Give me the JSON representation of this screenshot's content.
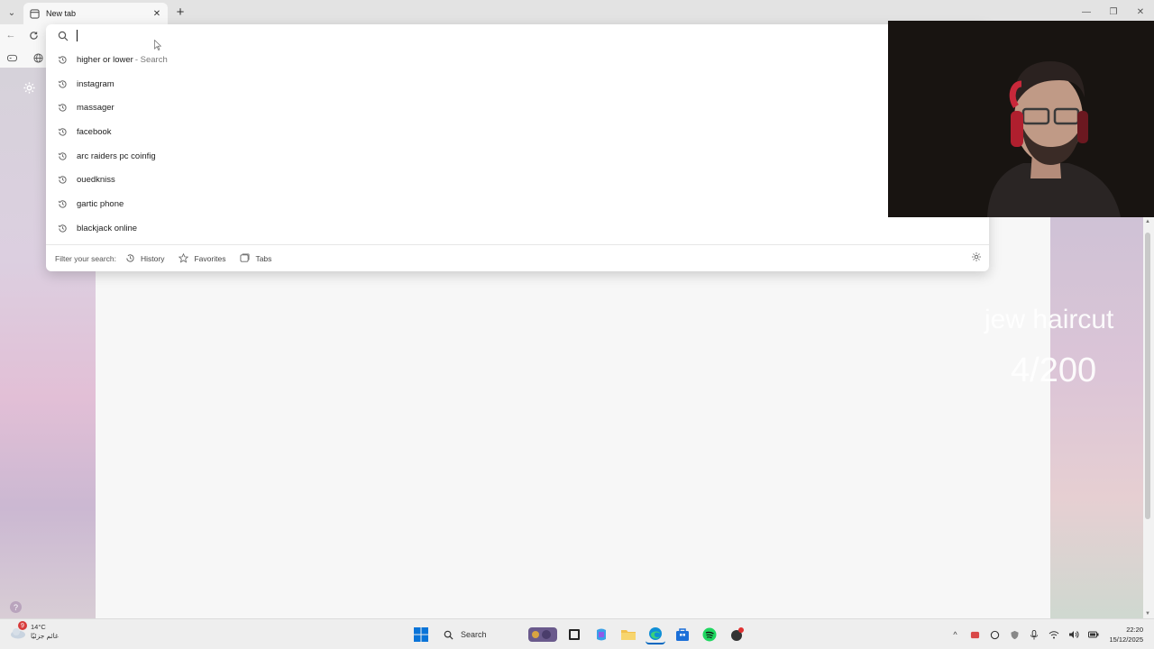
{
  "browser": {
    "tab_title": "New tab",
    "new_tab_symbol": "+",
    "window_controls": [
      "—",
      "❐",
      "✕"
    ]
  },
  "omnibox": {
    "input_value": "",
    "suggestions": [
      {
        "text": "higher or lower",
        "suffix": " - Search"
      },
      {
        "text": "instagram",
        "suffix": ""
      },
      {
        "text": "massager",
        "suffix": ""
      },
      {
        "text": "facebook",
        "suffix": ""
      },
      {
        "text": "arc raiders pc coinfig",
        "suffix": ""
      },
      {
        "text": "ouedkniss",
        "suffix": ""
      },
      {
        "text": "gartic phone",
        "suffix": ""
      },
      {
        "text": "blackjack online",
        "suffix": ""
      }
    ],
    "filter_label": "Filter your search:",
    "filters": [
      "History",
      "Favorites",
      "Tabs"
    ]
  },
  "overlay": {
    "title": "jew haircut",
    "count": "4/200"
  },
  "taskbar": {
    "weather_badge": "9",
    "weather_temp": "14°C",
    "weather_desc": "غائم جزئيًا",
    "search_label": "Search",
    "time": "22:20",
    "date": "15/12/2025"
  },
  "colors": {
    "accent": "#0067c0",
    "tab_active": "#f7f7f7",
    "tabstrip": "#e3e3e3"
  },
  "icons": [
    "search-icon",
    "history-icon",
    "star-icon",
    "tabs-icon",
    "gear-icon",
    "refresh-icon",
    "back-icon",
    "globe-icon",
    "windows-logo-icon",
    "edge-icon",
    "spotify-icon",
    "folder-icon"
  ]
}
